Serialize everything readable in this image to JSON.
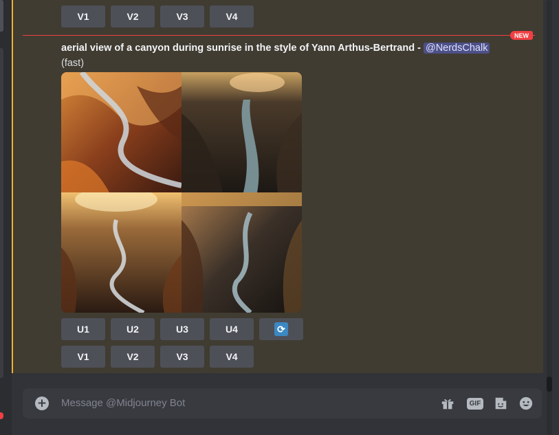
{
  "buttons_top": [
    "V1",
    "V2",
    "V3",
    "V4"
  ],
  "divider": {
    "badge": "NEW"
  },
  "message": {
    "prompt": "aerial view of a canyon during sunrise in the style of Yann Arthus-Bertrand",
    "separator": " - ",
    "mention": "@NerdsChalk",
    "speed": "(fast)"
  },
  "grid_images": [
    "canyon-image-1",
    "canyon-image-2",
    "canyon-image-3",
    "canyon-image-4"
  ],
  "upscale_buttons": [
    "U1",
    "U2",
    "U3",
    "U4"
  ],
  "reroll_icon": "reroll-icon",
  "variation_buttons": [
    "V1",
    "V2",
    "V3",
    "V4"
  ],
  "composer": {
    "placeholder": "Message @Midjourney Bot",
    "gif_label": "GIF",
    "icons": [
      "add-icon",
      "gift-icon",
      "gif-icon",
      "sticker-icon",
      "emoji-icon"
    ]
  },
  "colors": {
    "highlight_bg": "#403c32",
    "highlight_bar": "#f0b232",
    "new_red": "#f23f43",
    "button_bg": "#4e5058",
    "mention_bg": "#4d5088"
  }
}
